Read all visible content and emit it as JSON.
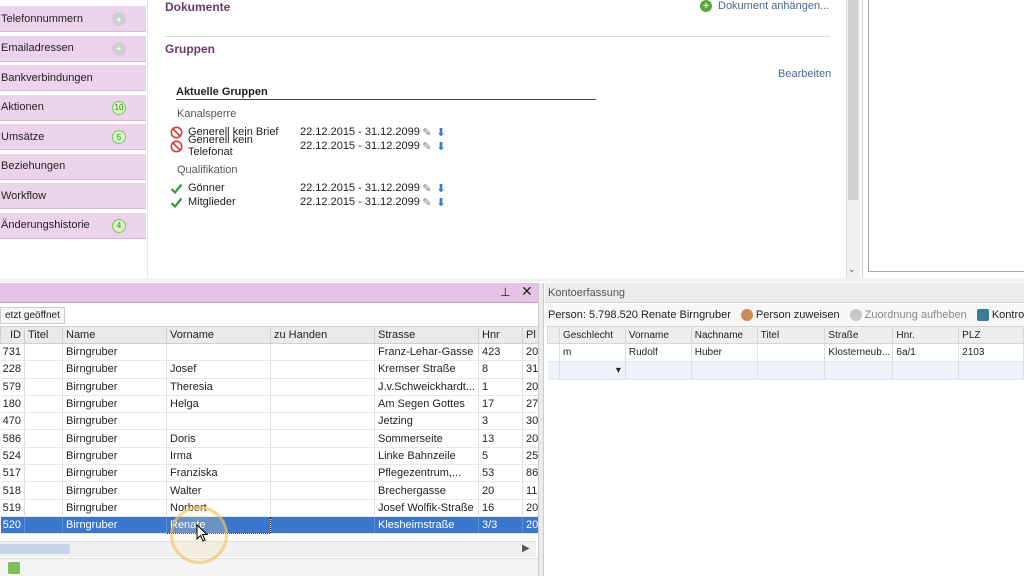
{
  "nav": {
    "items": [
      {
        "label": "Telefonnummern",
        "badge": "+",
        "badge_type": "plus"
      },
      {
        "label": "Emailadressen",
        "badge": "+",
        "badge_type": "plus"
      },
      {
        "label": "Bankverbindungen",
        "badge": "",
        "badge_type": "none"
      },
      {
        "label": "Aktionen",
        "badge": "10",
        "badge_type": "count"
      },
      {
        "label": "Umsätze",
        "badge": "5",
        "badge_type": "count"
      },
      {
        "label": "Beziehungen",
        "badge": "",
        "badge_type": "none"
      },
      {
        "label": "Workflow",
        "badge": "",
        "badge_type": "none"
      },
      {
        "label": "Änderungshistorie",
        "badge": "4",
        "badge_type": "count"
      }
    ]
  },
  "documents": {
    "title": "Dokumente",
    "attach_label": "Dokument anhängen..."
  },
  "groups": {
    "title": "Gruppen",
    "edit_label": "Bearbeiten",
    "current_title": "Aktuelle Gruppen",
    "categories": [
      {
        "name": "Kanalsperre",
        "entries": [
          {
            "name": "Generell kein Brief",
            "dates": "22.12.2015 - 31.12.2099",
            "icon": "blocked-icon"
          },
          {
            "name": "Generell kein Telefonat",
            "dates": "22.12.2015 - 31.12.2099",
            "icon": "blocked-icon"
          }
        ]
      },
      {
        "name": "Qualifikation",
        "entries": [
          {
            "name": "Gönner",
            "dates": "22.12.2015 - 31.12.2099",
            "icon": "check-icon"
          },
          {
            "name": "Mitglieder",
            "dates": "22.12.2015 - 31.12.2099",
            "icon": "check-icon"
          }
        ]
      }
    ]
  },
  "grid": {
    "tab_label": "etzt geöffnet",
    "columns": [
      "ID",
      "Titel",
      "Name",
      "Vorname",
      "zu Handen",
      "Strasse",
      "Hnr",
      "Pl"
    ],
    "rows": [
      [
        "731",
        "",
        "Birngruber",
        "",
        "",
        "Franz-Lehar-Gasse",
        "423",
        "20"
      ],
      [
        "228",
        "",
        "Birngruber",
        "Josef",
        "",
        "Kremser Straße",
        "8",
        "31"
      ],
      [
        "579",
        "",
        "Birngruber",
        "Theresia",
        "",
        "J.v.Schweickhardt...",
        "1",
        "20"
      ],
      [
        "180",
        "",
        "Birngruber",
        "Helga",
        "",
        "Am Segen Gottes",
        "17",
        "27"
      ],
      [
        "470",
        "",
        "Birngruber",
        "",
        "",
        "Jetzing",
        "3",
        "30"
      ],
      [
        "586",
        "",
        "Birngruber",
        "Doris",
        "",
        "Sommerseite",
        "13",
        "20"
      ],
      [
        "524",
        "",
        "Birngruber",
        "Irma",
        "",
        "Linke Bahnzeile",
        "5",
        "25"
      ],
      [
        "517",
        "",
        "Birngruber",
        "Franziska",
        "",
        "Pflegezentrum,...",
        "53",
        "86"
      ],
      [
        "518",
        "",
        "Birngruber",
        "Walter",
        "",
        "Brechergasse",
        "20",
        "11"
      ],
      [
        "519",
        "",
        "Birngruber",
        "Norbert",
        "",
        "Josef Wolfik-Straße",
        "16",
        "20"
      ],
      [
        "520",
        "",
        "Birngruber",
        "Renate",
        "",
        "Klesheimstraße",
        "3/3",
        "20"
      ]
    ],
    "selected_index": 10
  },
  "konto": {
    "title": "Kontoerfassung",
    "person_label": "Person:",
    "person_value": "5.798.520 Renate Birngruber",
    "assign_label": "Person zuweisen",
    "unassign_label": "Zuordnung aufheben",
    "check_label": "Kontrolle & I",
    "columns": [
      "Geschlecht",
      "Vorname",
      "Nachname",
      "Titel",
      "Straße",
      "Hnr.",
      "PLZ"
    ],
    "rows": [
      [
        "m",
        "Rudolf",
        "Huber",
        "",
        "Klosterneub...",
        "6a/1",
        "2103"
      ]
    ],
    "new_row_marker": "▾"
  },
  "colors": {
    "accent": "#6a3a6a",
    "nav_bg": "#ecd3ec",
    "selection": "#3a76cc"
  }
}
